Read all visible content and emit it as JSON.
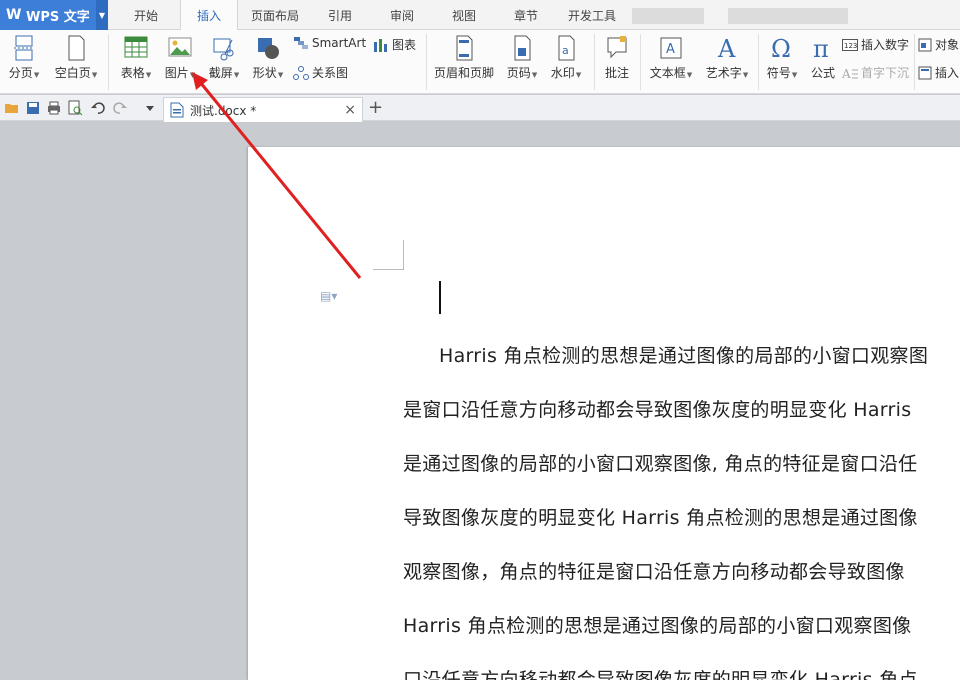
{
  "app": {
    "title": "WPS 文字"
  },
  "tabs": [
    "开始",
    "插入",
    "页面布局",
    "引用",
    "审阅",
    "视图",
    "章节",
    "开发工具"
  ],
  "active_tab": "插入",
  "ribbon": {
    "page_break": "分页",
    "blank_page": "空白页",
    "table": "表格",
    "picture": "图片",
    "screenshot": "截屏",
    "shape": "形状",
    "smartart": "SmartArt",
    "chart": "图表",
    "relation": "关系图",
    "header_footer": "页眉和页脚",
    "page_number": "页码",
    "watermark": "水印",
    "comment": "批注",
    "textbox": "文本框",
    "wordart": "艺术字",
    "symbol": "符号",
    "formula": "公式",
    "insert_number": "插入数字",
    "object": "对象",
    "drop_cap": "首字下沉",
    "insert_more": "插入"
  },
  "document": {
    "tab_name": "测试.docx *",
    "lines": [
      "Harris 角点检测的思想是通过图像的局部的小窗口观察图",
      "是窗口沿任意方向移动都会导致图像灰度的明显变化 Harris",
      "是通过图像的局部的小窗口观察图像, 角点的特征是窗口沿任",
      "导致图像灰度的明显变化 Harris 角点检测的思想是通过图像",
      "观察图像，角点的特征是窗口沿任意方向移动都会导致图像",
      "Harris 角点检测的思想是通过图像的局部的小窗口观察图像",
      "口沿任意方向移动都会导致图像灰度的明显变化 Harris 角点"
    ]
  },
  "colors": {
    "accent": "#2f6cc0",
    "annotation": "#e02020"
  }
}
